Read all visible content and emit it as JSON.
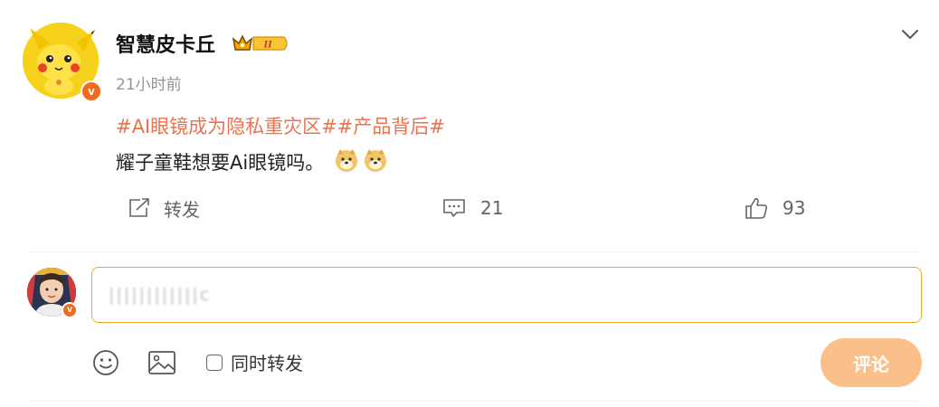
{
  "post": {
    "author": "智慧皮卡丘",
    "author_badge": "crown-level-II-icon",
    "badge_level": "II",
    "timestamp": "21小时前",
    "hashtags": [
      "#AI眼镜成为隐私重灾区#",
      "#产品背后#"
    ],
    "body_text": "耀子童鞋想要Ai眼镜吗。",
    "emoji_count": 2,
    "actions": {
      "repost_label": "转发",
      "comment_count": "21",
      "like_count": "93"
    },
    "verified_badge": "v"
  },
  "composer": {
    "input_value": "||||||||||||c",
    "sync_repost_label": "同时转发",
    "sync_repost_checked": false,
    "submit_label": "评论"
  },
  "colors": {
    "accent": "#eb7350",
    "input_border": "#f5a623",
    "submit_bg": "#fbc08a",
    "verified": "#f06a20"
  }
}
